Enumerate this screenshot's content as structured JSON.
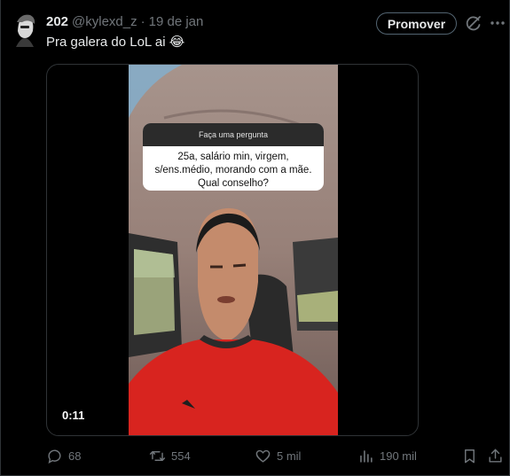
{
  "tweet": {
    "display_name": "202",
    "handle": "@kylexd_z",
    "separator": "·",
    "date": "19 de jan",
    "text": "Pra galera do LoL ai 😂",
    "promote_label": "Promover"
  },
  "media": {
    "question_header": "Faça uma pergunta",
    "question_text": "25a, salário min, virgem, s/ens.médio, morando com a mãe. Qual conselho?",
    "timestamp": "0:11"
  },
  "actions": {
    "replies": "68",
    "reposts": "554",
    "likes": "5 mil",
    "views": "190 mil"
  },
  "icons": [
    "grok-icon",
    "more-icon",
    "reply-icon",
    "repost-icon",
    "like-icon",
    "views-icon",
    "bookmark-icon",
    "share-icon"
  ],
  "colors": {
    "background": "#000000",
    "primary_text": "#e7e9ea",
    "secondary_text": "#71767b",
    "border": "#2f3336",
    "shirt_red": "#d8241f"
  }
}
